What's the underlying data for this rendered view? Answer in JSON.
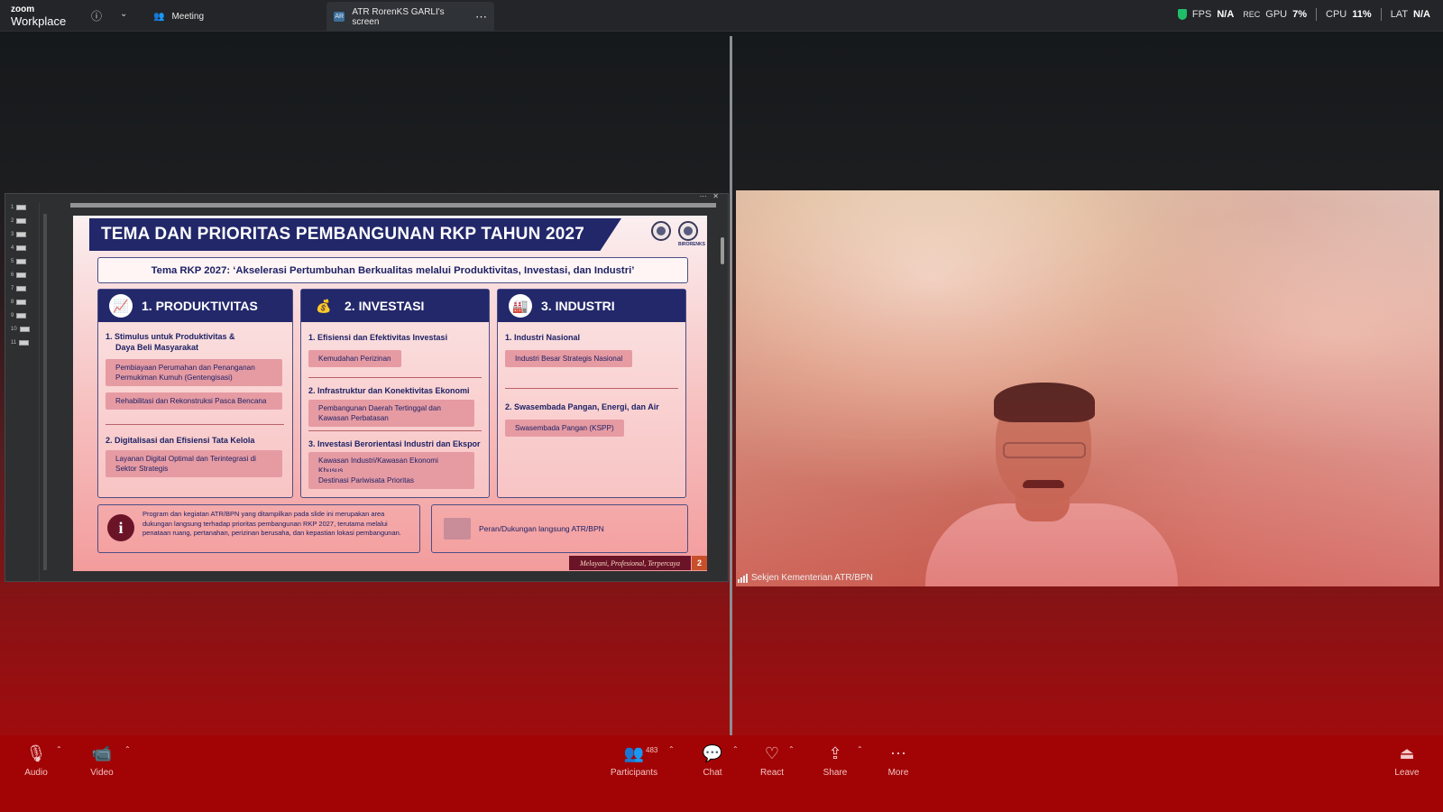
{
  "app": {
    "brand_top": "zoom",
    "brand_bottom": "Workplace"
  },
  "topbar": {
    "meeting_tab": "Meeting",
    "screen_tab": "ATR RorenKS GARLI's screen",
    "screen_badge": "AR",
    "stats": {
      "fps_label": "FPS",
      "fps_value": "N/A",
      "rec_label": "REC",
      "gpu_label": "GPU",
      "gpu_value": "7%",
      "cpu_label": "CPU",
      "cpu_value": "11%",
      "lat_label": "LAT",
      "lat_value": "N/A"
    }
  },
  "slide": {
    "title": "TEMA DAN PRIORITAS PEMBANGUNAN RKP TAHUN 2027",
    "seal_label": "BIRORENKS",
    "theme": "Tema RKP 2027: ‘Akselerasi Pertumbuhan Berkualitas melalui Produktivitas, Investasi, dan Industri’",
    "columns": [
      {
        "heading": "1. PRODUKTIVITAS",
        "items": [
          {
            "title_line1": "1.  Stimulus untuk Produktivitas &",
            "title_line2": "     Daya Beli Masyarakat",
            "pills": [
              "Pembiayaan Perumahan dan Penanganan Permukiman Kumuh (Gentengisasi)",
              "Rehabilitasi dan Rekonstruksi Pasca Bencana"
            ]
          },
          {
            "title_line1": "2.  Digitalisasi dan Efisiensi Tata Kelola",
            "pills": [
              "Layanan Digital Optimal dan Terintegrasi di Sektor Strategis"
            ]
          }
        ]
      },
      {
        "heading": "2. INVESTASI",
        "items": [
          {
            "title_line1": "1.  Efisiensi dan Efektivitas Investasi",
            "pills": [
              "Kemudahan Perizinan"
            ]
          },
          {
            "title_line1": "2.  Infrastruktur dan Konektivitas Ekonomi",
            "pills": [
              "Pembangunan Daerah Tertinggal dan Kawasan Perbatasan"
            ]
          },
          {
            "title_line1": "3.  Investasi Berorientasi Industri dan Ekspor",
            "pills": [
              "Kawasan Industri/Kawasan Ekonomi Khusus",
              "Destinasi Pariwisata Prioritas"
            ]
          }
        ]
      },
      {
        "heading": "3. INDUSTRI",
        "items": [
          {
            "title_line1": "1.  Industri Nasional",
            "pills": [
              "Industri Besar Strategis Nasional"
            ]
          },
          {
            "title_line1": "2.  Swasembada Pangan, Energi, dan Air",
            "pills": [
              "Swasembada Pangan (KSPP)"
            ]
          }
        ]
      }
    ],
    "note": "Program dan kegiatan ATR/BPN yang ditampilkan pada slide ini merupakan area dukungan langsung terhadap prioritas pembangunan RKP 2027, terutama melalui penataan ruang, pertanahan, perizinan berusaha, dan kepastian lokasi pembangunan.",
    "legend": "Peran/Dukungan langsung ATR/BPN",
    "footer_tag": "Melayani, Profesional, Terpercaya",
    "page_number": "2",
    "thumb_numbers": [
      "1",
      "2",
      "3",
      "4",
      "5",
      "6",
      "7",
      "8",
      "9",
      "10",
      "11"
    ]
  },
  "video": {
    "participant_name": "Sekjen Kementerian ATR/BPN"
  },
  "toolbar": {
    "audio": "Audio",
    "video": "Video",
    "participants": "Participants",
    "participants_count": "483",
    "chat": "Chat",
    "react": "React",
    "share": "Share",
    "more": "More",
    "leave": "Leave"
  },
  "colors": {
    "toolbar_bg": "#a20405",
    "slide_navy": "#22276a",
    "accent_maroon": "#6b1428"
  }
}
